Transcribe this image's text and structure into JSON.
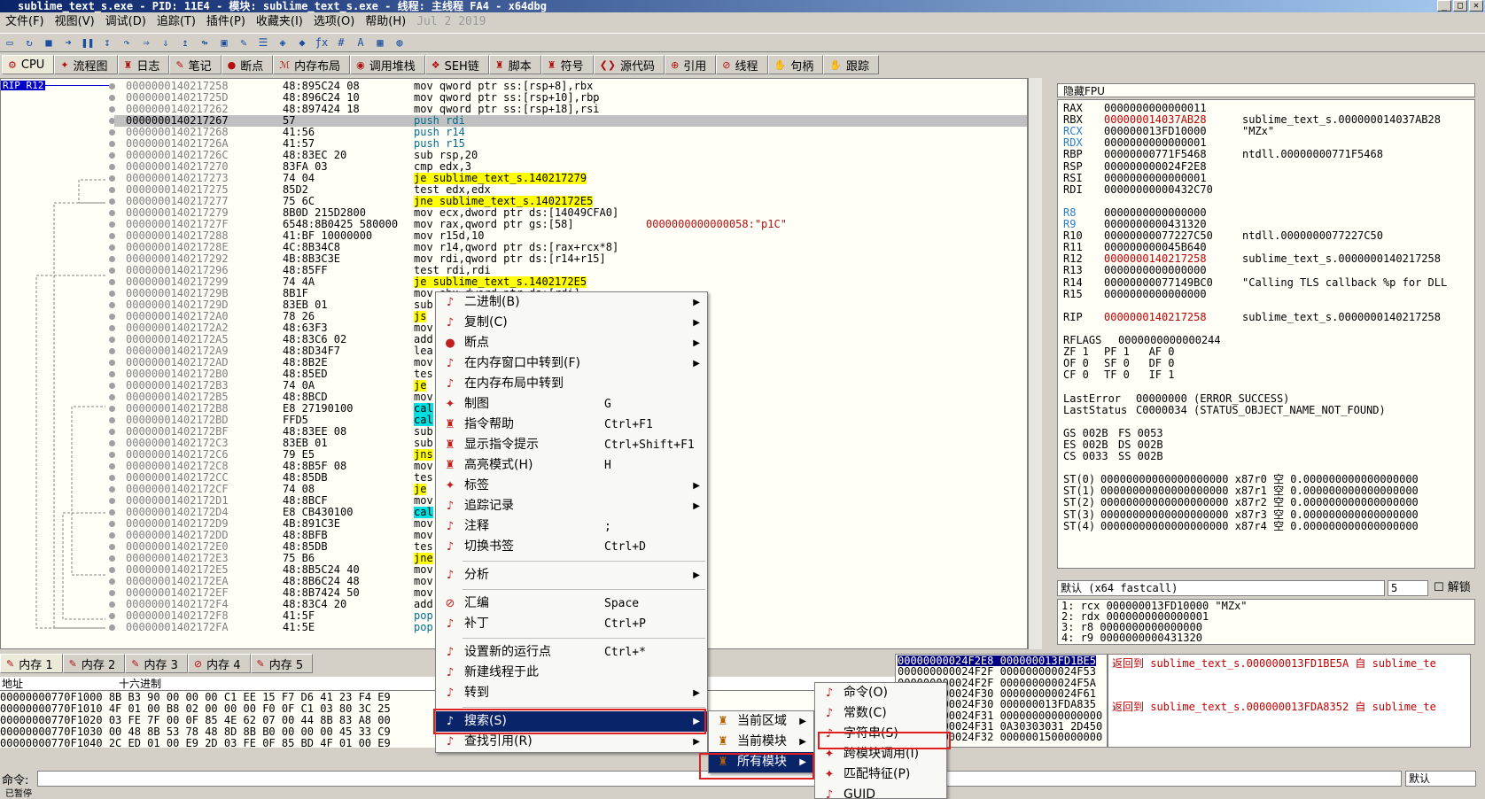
{
  "window": {
    "title": "sublime_text_s.exe - PID: 11E4 - 模块: sublime_text_s.exe - 线程: 主线程 FA4 - x64dbg"
  },
  "menubar": {
    "items": [
      "文件(F)",
      "视图(V)",
      "调试(D)",
      "追踪(T)",
      "插件(P)",
      "收藏夹(I)",
      "选项(O)",
      "帮助(H)"
    ],
    "date": "Jul 2 2019"
  },
  "tabs": [
    "CPU",
    "流程图",
    "日志",
    "笔记",
    "断点",
    "内存布局",
    "调用堆栈",
    "SEH链",
    "脚本",
    "符号",
    "源代码",
    "引用",
    "线程",
    "句柄",
    "跟踪"
  ],
  "cpu": {
    "rip_tag": "RIP R12",
    "rows": [
      {
        "addr": "0000000140217258",
        "bytes": "48:895C24 08",
        "dis": "mov qword ptr ss:[rsp+8],rbx"
      },
      {
        "addr": "000000014021725D",
        "bytes": "48:896C24 10",
        "dis": "mov qword ptr ss:[rsp+10],rbp"
      },
      {
        "addr": "0000000140217262",
        "bytes": "48:897424 18",
        "dis": "mov qword ptr ss:[rsp+18],rsi"
      },
      {
        "addr": "0000000140217267",
        "bytes": "57",
        "dis": "push rdi"
      },
      {
        "addr": "0000000140217268",
        "bytes": "41:56",
        "dis": "push r14"
      },
      {
        "addr": "000000014021726A",
        "bytes": "41:57",
        "dis": "push r15"
      },
      {
        "addr": "000000014021726C",
        "bytes": "48:83EC 20",
        "dis": "sub rsp,20"
      },
      {
        "addr": "0000000140217270",
        "bytes": "83FA 03",
        "dis": "cmp edx,3"
      },
      {
        "addr": "0000000140217273",
        "bytes": "74 04",
        "dis": "je sublime_text_s.140217279"
      },
      {
        "addr": "0000000140217275",
        "bytes": "85D2",
        "dis": "test edx,edx"
      },
      {
        "addr": "0000000140217277",
        "bytes": "75 6C",
        "dis": "jne sublime_text_s.1402172E5"
      },
      {
        "addr": "0000000140217279",
        "bytes": "8B0D 215D2800",
        "dis": "mov ecx,dword ptr ds:[14049CFA0]"
      },
      {
        "addr": "000000014021727F",
        "bytes": "6548:8B0425 580000",
        "dis": "mov rax,qword ptr gs:[58]",
        "cmt": "0000000000000058:\"p1C\""
      },
      {
        "addr": "0000000140217288",
        "bytes": "41:BF 10000000",
        "dis": "mov r15d,10"
      },
      {
        "addr": "000000014021728E",
        "bytes": "4C:8B34C8",
        "dis": "mov r14,qword ptr ds:[rax+rcx*8]"
      },
      {
        "addr": "0000000140217292",
        "bytes": "4B:8B3C3E",
        "dis": "mov rdi,qword ptr ds:[r14+r15]"
      },
      {
        "addr": "0000000140217296",
        "bytes": "48:85FF",
        "dis": "test rdi,rdi"
      },
      {
        "addr": "0000000140217299",
        "bytes": "74 4A",
        "dis": "je sublime_text_s.1402172E5"
      },
      {
        "addr": "000000014021729B",
        "bytes": "8B1F",
        "dis": "mov ebx,dword ptr ds:[rdi]"
      },
      {
        "addr": "000000014021729D",
        "bytes": "83EB 01",
        "dis": "sub"
      },
      {
        "addr": "00000001402172A0",
        "bytes": "78 26",
        "dis": "js"
      },
      {
        "addr": "00000001402172A2",
        "bytes": "48:63F3",
        "dis": "mov"
      },
      {
        "addr": "00000001402172A5",
        "bytes": "48:83C6 02",
        "dis": "add"
      },
      {
        "addr": "00000001402172A9",
        "bytes": "48:8D34F7",
        "dis": "lea"
      },
      {
        "addr": "00000001402172AD",
        "bytes": "48:8B2E",
        "dis": "mov"
      },
      {
        "addr": "00000001402172B0",
        "bytes": "48:85ED",
        "dis": "tes"
      },
      {
        "addr": "00000001402172B3",
        "bytes": "74 0A",
        "dis": "je"
      },
      {
        "addr": "00000001402172B5",
        "bytes": "48:8BCD",
        "dis": "mov"
      },
      {
        "addr": "00000001402172B8",
        "bytes": "E8 27190100",
        "dis": "cal"
      },
      {
        "addr": "00000001402172BD",
        "bytes": "FFD5",
        "dis": "cal"
      },
      {
        "addr": "00000001402172BF",
        "bytes": "48:83EE 08",
        "dis": "sub"
      },
      {
        "addr": "00000001402172C3",
        "bytes": "83EB 01",
        "dis": "sub"
      },
      {
        "addr": "00000001402172C6",
        "bytes": "79 E5",
        "dis": "jns"
      },
      {
        "addr": "00000001402172C8",
        "bytes": "48:8B5F 08",
        "dis": "mov"
      },
      {
        "addr": "00000001402172CC",
        "bytes": "48:85DB",
        "dis": "tes"
      },
      {
        "addr": "00000001402172CF",
        "bytes": "74 08",
        "dis": "je"
      },
      {
        "addr": "00000001402172D1",
        "bytes": "48:8BCF",
        "dis": "mov"
      },
      {
        "addr": "00000001402172D4",
        "bytes": "E8 CB430100",
        "dis": "cal"
      },
      {
        "addr": "00000001402172D9",
        "bytes": "4B:891C3E",
        "dis": "mov"
      },
      {
        "addr": "00000001402172DD",
        "bytes": "48:8BFB",
        "dis": "mov"
      },
      {
        "addr": "00000001402172E0",
        "bytes": "48:85DB",
        "dis": "tes"
      },
      {
        "addr": "00000001402172E3",
        "bytes": "75 B6",
        "dis": "jne"
      },
      {
        "addr": "00000001402172E5",
        "bytes": "48:8B5C24 40",
        "dis": "mov"
      },
      {
        "addr": "00000001402172EA",
        "bytes": "48:8B6C24 48",
        "dis": "mov"
      },
      {
        "addr": "00000001402172EF",
        "bytes": "48:8B7424 50",
        "dis": "mov"
      },
      {
        "addr": "00000001402172F4",
        "bytes": "48:83C4 20",
        "dis": "add"
      },
      {
        "addr": "00000001402172F8",
        "bytes": "41:5F",
        "dis": "pop"
      },
      {
        "addr": "00000001402172FA",
        "bytes": "41:5E",
        "dis": "pop"
      }
    ]
  },
  "registers": {
    "header": "隐藏FPU",
    "lines": [
      {
        "n": "RAX",
        "v": "0000000000000011",
        "c": ""
      },
      {
        "n": "RBX",
        "v": "000000014037AB28",
        "c": "sublime_text_s.000000014037AB28",
        "red": true
      },
      {
        "n": "RCX",
        "v": "000000013FD10000",
        "c": "\"MZx\""
      },
      {
        "n": "RDX",
        "v": "0000000000000001",
        "c": ""
      },
      {
        "n": "RBP",
        "v": "00000000771F5468",
        "c": "ntdll.00000000771F5468"
      },
      {
        "n": "RSP",
        "v": "000000000024F2E8",
        "c": ""
      },
      {
        "n": "RSI",
        "v": "0000000000000001",
        "c": ""
      },
      {
        "n": "RDI",
        "v": "00000000000432C70",
        "c": ""
      },
      {
        "n": "",
        "v": "",
        "c": ""
      },
      {
        "n": "R8",
        "v": "0000000000000000",
        "c": ""
      },
      {
        "n": "R9",
        "v": "0000000000431320",
        "c": ""
      },
      {
        "n": "R10",
        "v": "00000000077227C50",
        "c": "ntdll.0000000077227C50"
      },
      {
        "n": "R11",
        "v": "000000000045B640",
        "c": ""
      },
      {
        "n": "R12",
        "v": "0000000140217258",
        "c": "sublime_text_s.0000000140217258",
        "red": true
      },
      {
        "n": "R13",
        "v": "0000000000000000",
        "c": ""
      },
      {
        "n": "R14",
        "v": "00000000077149BC0",
        "c": "\"Calling TLS callback %p for DLL"
      },
      {
        "n": "R15",
        "v": "0000000000000000",
        "c": ""
      },
      {
        "n": "",
        "v": "",
        "c": ""
      },
      {
        "n": "RIP",
        "v": "0000000140217258",
        "c": "sublime_text_s.0000000140217258",
        "red": true
      },
      {
        "n": "",
        "v": "",
        "c": ""
      },
      {
        "n": "RFLAGS",
        "v": "0000000000000244",
        "c": ""
      },
      {
        "n": "ZF 1",
        "v": "PF 1   AF 0",
        "c": ""
      },
      {
        "n": "OF 0",
        "v": "SF 0   DF 0",
        "c": ""
      },
      {
        "n": "CF 0",
        "v": "TF 0   IF 1",
        "c": ""
      },
      {
        "n": "",
        "v": "",
        "c": ""
      },
      {
        "n": "LastError",
        "v": "00000000 (ERROR_SUCCESS)",
        "c": ""
      },
      {
        "n": "LastStatus",
        "v": "C0000034 (STATUS_OBJECT_NAME_NOT_FOUND)",
        "c": ""
      },
      {
        "n": "",
        "v": "",
        "c": ""
      },
      {
        "n": "GS 002B",
        "v": "FS 0053",
        "c": ""
      },
      {
        "n": "ES 002B",
        "v": "DS 002B",
        "c": ""
      },
      {
        "n": "CS 0033",
        "v": "SS 002B",
        "c": ""
      },
      {
        "n": "",
        "v": "",
        "c": ""
      },
      {
        "n": "ST(0)",
        "v": "00000000000000000000 x87r0 空 0.000000000000000000",
        "c": ""
      },
      {
        "n": "ST(1)",
        "v": "00000000000000000000 x87r1 空 0.000000000000000000",
        "c": ""
      },
      {
        "n": "ST(2)",
        "v": "00000000000000000000 x87r2 空 0.000000000000000000",
        "c": ""
      },
      {
        "n": "ST(3)",
        "v": "00000000000000000000 x87r3 空 0.000000000000000000",
        "c": ""
      },
      {
        "n": "ST(4)",
        "v": "00000000000000000000 x87r4 空 0.000000000000000000",
        "c": ""
      }
    ]
  },
  "callconv": {
    "label": "默认 (x64 fastcall)",
    "argcount": "5",
    "unlock": "解锁"
  },
  "args": [
    "1: rcx 000000013FD10000 \"MZx\"",
    "2: rdx 0000000000000001",
    "3: r8 0000000000000000",
    "4: r9 0000000000431320"
  ],
  "memtabs": [
    "内存 1",
    "内存 2",
    "内存 3",
    "内存 4",
    "内存 5"
  ],
  "memhdr": {
    "addr": "地址",
    "hex": "十六进制"
  },
  "memrows": [
    "00000000770F1000 8B B3 90 00 00 00 C1 EE 15 F7 D6 41 23 F4 E9",
    "00000000770F1010 4F 01 00 B8 02 00 00 00 F0 0F C1 03 80 3C 25",
    "00000000770F1020 03 FE 7F 00 0F 85 4E 62 07 00 44 8B 83 A8 00",
    "00000000770F1030 00 48 8B 53 78 48 8D 8B B0 00 00 00 45 33 C9",
    "00000000770F1040 2C ED 01 00 E9 2D 03 FE 0F 85 BD 4F 01 00 E9"
  ],
  "stack": [
    "00000000024F2E8 000000013FD1BE5",
    "000000000024F2F 000000000024F53",
    "000000000024F2F 000000000024F5A",
    "000000000024F30 000000000024F61",
    "000000000024F30 000000013FDA835",
    "000000000024F31 0000000000000000",
    "000000000024F31 0A30303031 2D450",
    "000000000024F32 0000001500000000"
  ],
  "stackcmt": [
    "返回到 sublime_text_s.000000013FD1BE5A 自 sublime_te",
    "",
    "",
    "",
    "返回到 sublime_text_s.000000013FDA8352 自 sublime_te"
  ],
  "cmd": {
    "label": "命令:",
    "default": "默认"
  },
  "status": "已暂停",
  "context_menu": {
    "items": [
      {
        "label": "二进制(B)",
        "sc": "",
        "sub": true
      },
      {
        "label": "复制(C)",
        "sc": "",
        "sub": true
      },
      {
        "label": "断点",
        "sc": "",
        "sub": true
      },
      {
        "label": "在内存窗口中转到(F)",
        "sc": "",
        "sub": true
      },
      {
        "label": "在内存布局中转到",
        "sc": "",
        "sub": false
      },
      {
        "label": "制图",
        "sc": "G",
        "sub": false
      },
      {
        "label": "指令帮助",
        "sc": "Ctrl+F1",
        "sub": false
      },
      {
        "label": "显示指令提示",
        "sc": "Ctrl+Shift+F1",
        "sub": false
      },
      {
        "label": "高亮模式(H)",
        "sc": "H",
        "sub": false
      },
      {
        "label": "标签",
        "sc": "",
        "sub": true
      },
      {
        "label": "追踪记录",
        "sc": "",
        "sub": true
      },
      {
        "label": "注释",
        "sc": ";",
        "sub": false
      },
      {
        "label": "切换书签",
        "sc": "Ctrl+D",
        "sub": false
      },
      {
        "label": "分析",
        "sc": "",
        "sub": true
      },
      {
        "label": "汇编",
        "sc": "Space",
        "sub": false
      },
      {
        "label": "补丁",
        "sc": "Ctrl+P",
        "sub": false
      },
      {
        "label": "设置新的运行点",
        "sc": "Ctrl+*",
        "sub": false
      },
      {
        "label": "新建线程于此",
        "sc": "",
        "sub": false
      },
      {
        "label": "转到",
        "sc": "",
        "sub": true
      },
      {
        "label": "搜索(S)",
        "sc": "",
        "sub": true
      },
      {
        "label": "查找引用(R)",
        "sc": "",
        "sub": true
      }
    ],
    "search_sub": [
      "当前区域",
      "当前模块",
      "所有模块"
    ],
    "modules_sub": [
      "命令(O)",
      "常数(C)",
      "字符串(S)",
      "跨模块调用(I)",
      "匹配特征(P)",
      "GUID"
    ]
  }
}
